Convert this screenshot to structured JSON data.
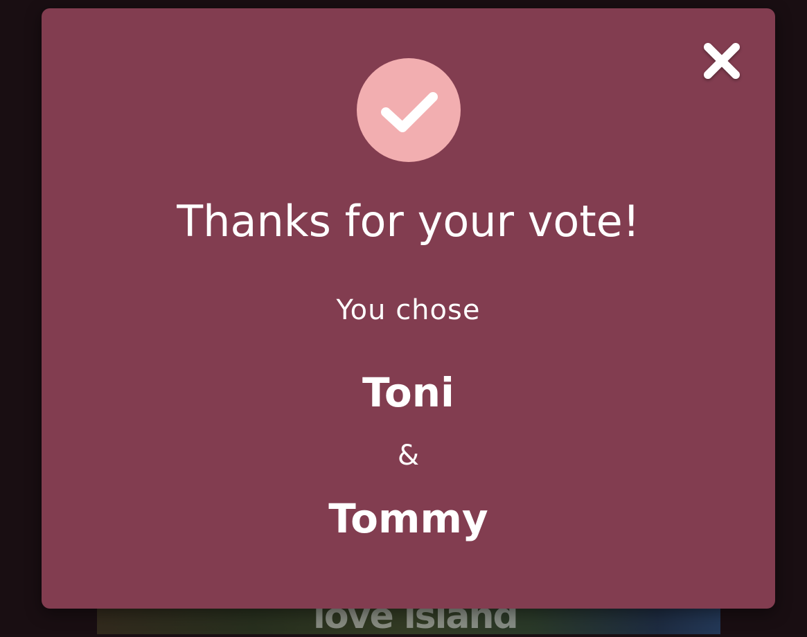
{
  "background": {
    "logo_text": "love island"
  },
  "modal": {
    "title": "Thanks for your vote!",
    "subtitle": "You chose",
    "choices": [
      "Toni",
      "Tommy"
    ],
    "separator": "&",
    "icons": {
      "success": "check-icon",
      "close": "close-icon"
    },
    "colors": {
      "modal_background": "#823d50",
      "check_circle": "#f2aeb0",
      "text": "#ffffff",
      "page_backdrop": "#190e12"
    }
  }
}
